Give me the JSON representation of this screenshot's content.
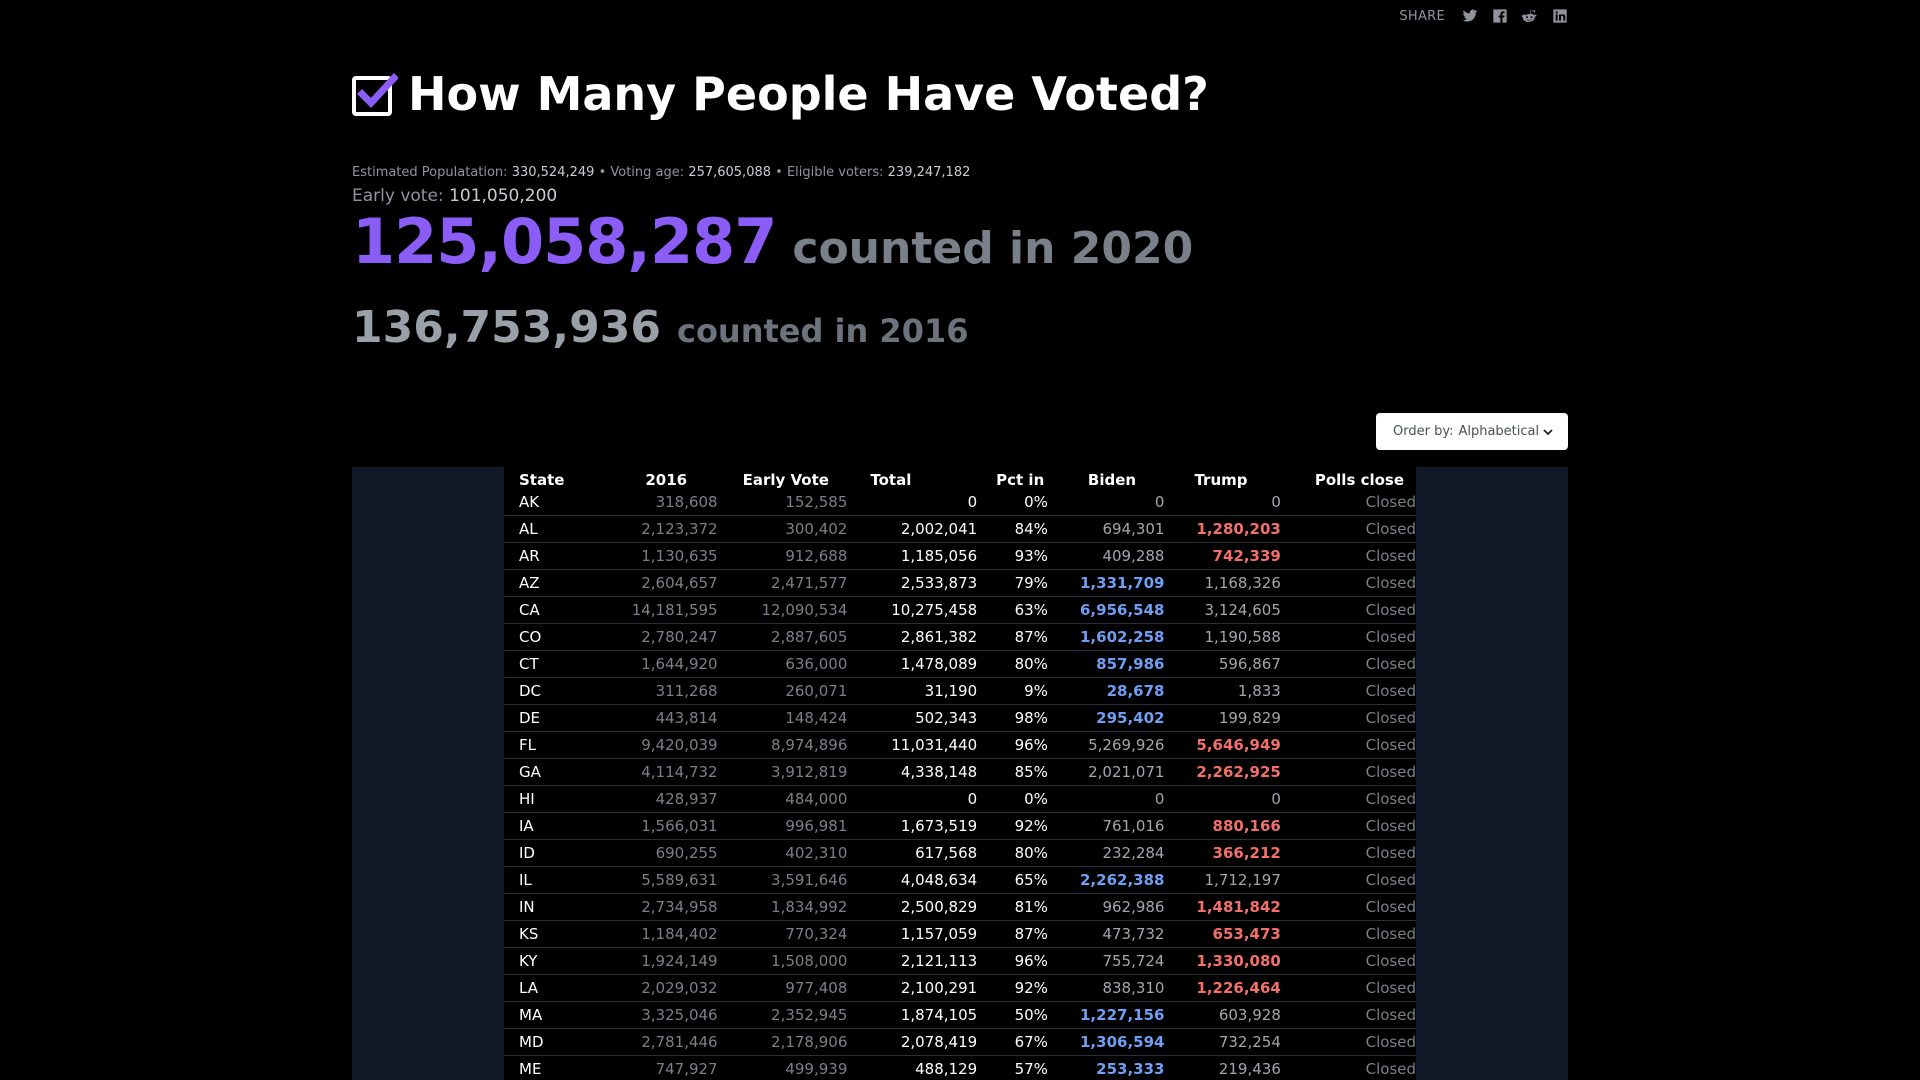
{
  "share": {
    "label": "SHARE",
    "icons": [
      "twitter-icon",
      "facebook-icon",
      "reddit-icon",
      "linkedin-icon"
    ]
  },
  "header": {
    "title": "How Many People Have Voted?",
    "icon": "checkbox-checked-icon"
  },
  "stats": {
    "population_label": "Estimated Populatation:",
    "population_value": "330,524,249",
    "voting_age_label": "Voting age:",
    "voting_age_value": "257,605,088",
    "eligible_label": "Eligible voters:",
    "eligible_value": "239,247,182",
    "separator": "•"
  },
  "early_vote": {
    "label": "Early vote:",
    "value": "101,050,200"
  },
  "count_2020": {
    "value": "125,058,287",
    "suffix": "counted in 2020"
  },
  "count_2016": {
    "value": "136,753,936",
    "suffix": "counted in 2016"
  },
  "order": {
    "label": "Order by:",
    "value": "Alphabetical"
  },
  "colors": {
    "accent": "#8b5cf6",
    "biden": "#6f9ef3",
    "trump": "#f2706a",
    "panel": "#111827"
  },
  "table": {
    "headers": [
      "State",
      "2016",
      "Early Vote",
      "Total",
      "Pct in",
      "Biden",
      "Trump",
      "Polls close"
    ],
    "rows": [
      {
        "state": "AK",
        "y2016": "318,608",
        "early": "152,585",
        "total": "0",
        "pct": "0%",
        "biden": "0",
        "trump": "0",
        "polls": "Closed",
        "winner": ""
      },
      {
        "state": "AL",
        "y2016": "2,123,372",
        "early": "300,402",
        "total": "2,002,041",
        "pct": "84%",
        "biden": "694,301",
        "trump": "1,280,203",
        "polls": "Closed",
        "winner": "trump"
      },
      {
        "state": "AR",
        "y2016": "1,130,635",
        "early": "912,688",
        "total": "1,185,056",
        "pct": "93%",
        "biden": "409,288",
        "trump": "742,339",
        "polls": "Closed",
        "winner": "trump"
      },
      {
        "state": "AZ",
        "y2016": "2,604,657",
        "early": "2,471,577",
        "total": "2,533,873",
        "pct": "79%",
        "biden": "1,331,709",
        "trump": "1,168,326",
        "polls": "Closed",
        "winner": "biden"
      },
      {
        "state": "CA",
        "y2016": "14,181,595",
        "early": "12,090,534",
        "total": "10,275,458",
        "pct": "63%",
        "biden": "6,956,548",
        "trump": "3,124,605",
        "polls": "Closed",
        "winner": "biden"
      },
      {
        "state": "CO",
        "y2016": "2,780,247",
        "early": "2,887,605",
        "total": "2,861,382",
        "pct": "87%",
        "biden": "1,602,258",
        "trump": "1,190,588",
        "polls": "Closed",
        "winner": "biden"
      },
      {
        "state": "CT",
        "y2016": "1,644,920",
        "early": "636,000",
        "total": "1,478,089",
        "pct": "80%",
        "biden": "857,986",
        "trump": "596,867",
        "polls": "Closed",
        "winner": "biden"
      },
      {
        "state": "DC",
        "y2016": "311,268",
        "early": "260,071",
        "total": "31,190",
        "pct": "9%",
        "biden": "28,678",
        "trump": "1,833",
        "polls": "Closed",
        "winner": "biden"
      },
      {
        "state": "DE",
        "y2016": "443,814",
        "early": "148,424",
        "total": "502,343",
        "pct": "98%",
        "biden": "295,402",
        "trump": "199,829",
        "polls": "Closed",
        "winner": "biden"
      },
      {
        "state": "FL",
        "y2016": "9,420,039",
        "early": "8,974,896",
        "total": "11,031,440",
        "pct": "96%",
        "biden": "5,269,926",
        "trump": "5,646,949",
        "polls": "Closed",
        "winner": "trump"
      },
      {
        "state": "GA",
        "y2016": "4,114,732",
        "early": "3,912,819",
        "total": "4,338,148",
        "pct": "85%",
        "biden": "2,021,071",
        "trump": "2,262,925",
        "polls": "Closed",
        "winner": "trump"
      },
      {
        "state": "HI",
        "y2016": "428,937",
        "early": "484,000",
        "total": "0",
        "pct": "0%",
        "biden": "0",
        "trump": "0",
        "polls": "Closed",
        "winner": ""
      },
      {
        "state": "IA",
        "y2016": "1,566,031",
        "early": "996,981",
        "total": "1,673,519",
        "pct": "92%",
        "biden": "761,016",
        "trump": "880,166",
        "polls": "Closed",
        "winner": "trump"
      },
      {
        "state": "ID",
        "y2016": "690,255",
        "early": "402,310",
        "total": "617,568",
        "pct": "80%",
        "biden": "232,284",
        "trump": "366,212",
        "polls": "Closed",
        "winner": "trump"
      },
      {
        "state": "IL",
        "y2016": "5,589,631",
        "early": "3,591,646",
        "total": "4,048,634",
        "pct": "65%",
        "biden": "2,262,388",
        "trump": "1,712,197",
        "polls": "Closed",
        "winner": "biden"
      },
      {
        "state": "IN",
        "y2016": "2,734,958",
        "early": "1,834,992",
        "total": "2,500,829",
        "pct": "81%",
        "biden": "962,986",
        "trump": "1,481,842",
        "polls": "Closed",
        "winner": "trump"
      },
      {
        "state": "KS",
        "y2016": "1,184,402",
        "early": "770,324",
        "total": "1,157,059",
        "pct": "87%",
        "biden": "473,732",
        "trump": "653,473",
        "polls": "Closed",
        "winner": "trump"
      },
      {
        "state": "KY",
        "y2016": "1,924,149",
        "early": "1,508,000",
        "total": "2,121,113",
        "pct": "96%",
        "biden": "755,724",
        "trump": "1,330,080",
        "polls": "Closed",
        "winner": "trump"
      },
      {
        "state": "LA",
        "y2016": "2,029,032",
        "early": "977,408",
        "total": "2,100,291",
        "pct": "92%",
        "biden": "838,310",
        "trump": "1,226,464",
        "polls": "Closed",
        "winner": "trump"
      },
      {
        "state": "MA",
        "y2016": "3,325,046",
        "early": "2,352,945",
        "total": "1,874,105",
        "pct": "50%",
        "biden": "1,227,156",
        "trump": "603,928",
        "polls": "Closed",
        "winner": "biden"
      },
      {
        "state": "MD",
        "y2016": "2,781,446",
        "early": "2,178,906",
        "total": "2,078,419",
        "pct": "67%",
        "biden": "1,306,594",
        "trump": "732,254",
        "polls": "Closed",
        "winner": "biden"
      },
      {
        "state": "ME",
        "y2016": "747,927",
        "early": "499,939",
        "total": "488,129",
        "pct": "57%",
        "biden": "253,333",
        "trump": "219,436",
        "polls": "Closed",
        "winner": "biden"
      }
    ]
  }
}
